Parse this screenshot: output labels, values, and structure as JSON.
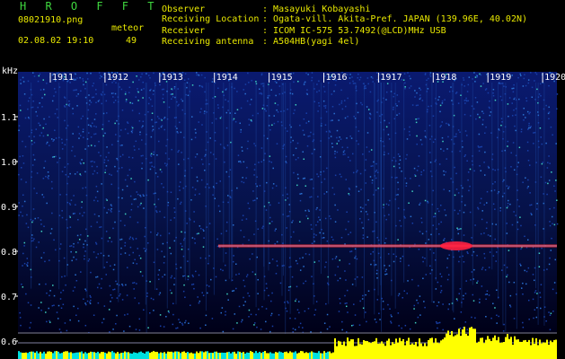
{
  "header": {
    "title": "H R O F F T",
    "filename": "08021910.png",
    "meteor_label": "meteor",
    "datetime": "02.08.02 19:10",
    "meteor_count": "49",
    "info": [
      {
        "label": "Observer",
        "value": "Masayuki Kobayashi"
      },
      {
        "label": "Receiving Location",
        "value": "Ogata-vill. Akita-Pref. JAPAN (139.96E, 40.02N)"
      },
      {
        "label": "Receiver",
        "value": "ICOM IC-575 53.7492(@LCD)MHz USB"
      },
      {
        "label": "Receiving antenna",
        "value": "A504HB(yagi 4el)"
      }
    ]
  },
  "axis": {
    "unit_label": "kHz",
    "y_ticks": [
      "1.1",
      "1.0",
      "0.9",
      "0.8",
      "0.7",
      "0.6"
    ],
    "y_tick_values": [
      1.1,
      1.0,
      0.9,
      0.8,
      0.7,
      0.6
    ],
    "x_ticks": [
      "1911",
      "1912",
      "1913",
      "1914",
      "1915",
      "1916",
      "1917",
      "1918",
      "1919",
      "1920"
    ]
  },
  "colors": {
    "header_text": "#e8e800",
    "title_text": "#3fd83f",
    "axis_text": "#ffffff",
    "spectrum_bg": "#000060",
    "signal_line": "#ff3030",
    "level_bar": "#ffff00",
    "level_bar_alt": "#00e0e0"
  }
}
